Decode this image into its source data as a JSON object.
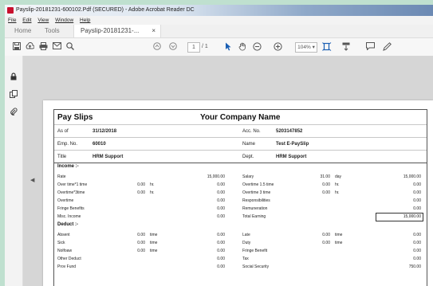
{
  "window": {
    "title": "Payslip-20181231-600102.Pdf (SECURED) - Adobe Acrobat Reader DC"
  },
  "menu": [
    "File",
    "Edit",
    "View",
    "Window",
    "Help"
  ],
  "tabs": {
    "home": "Home",
    "tools": "Tools",
    "document": "Payslip-20181231-...",
    "close": "×"
  },
  "toolbar": {
    "page_current": "1",
    "page_total": "/ 1",
    "zoom": "104%"
  },
  "icons": {
    "save": "save-icon",
    "upload": "upload-icon",
    "print": "print-icon",
    "email": "email-icon",
    "search": "search-icon",
    "prev": "prev-page-icon",
    "next": "next-page-icon",
    "select": "select-cursor-icon",
    "hand": "hand-icon",
    "zoom_out": "zoom-out-icon",
    "zoom_in": "zoom-in-icon",
    "fit": "fit-page-icon",
    "scroll": "scroll-mode-icon",
    "comment": "comment-icon",
    "pen": "pen-icon",
    "lock": "lock-icon",
    "pages": "pages-icon",
    "attach": "attachment-icon",
    "collapse": "collapse-arrow-icon"
  },
  "colors": {
    "background": "#bfe0cf",
    "accent": "#1a5fb4"
  },
  "payslip": {
    "title": "Pay Slips",
    "company": "Your Company Name",
    "header": [
      {
        "label": "As of",
        "value": "31/12/2018",
        "label2": "Acc. No.",
        "value2": "5203147852"
      },
      {
        "label": "Emp. No.",
        "value": "60010",
        "label2": "Name",
        "value2": "Test E-PaySlip"
      },
      {
        "label": "Title",
        "value": "HRM Support",
        "label2": "Dept.",
        "value2": "HRM Support"
      }
    ],
    "income_label": "Income :-",
    "income_rows": [
      {
        "a": "Rate",
        "b": "",
        "c": "",
        "d": "15,000.00",
        "e": "Salary",
        "f": "31.00",
        "g": "day",
        "h": "15,000.00"
      },
      {
        "a": "Over time*1 time",
        "b": "0.00",
        "c": "hr.",
        "d": "0.00",
        "e": "Overtime 1.5 time",
        "f": "0.00",
        "g": "hr.",
        "h": "0.00"
      },
      {
        "a": "Overtime*3time",
        "b": "0.00",
        "c": "hr.",
        "d": "0.00",
        "e": "Overtime 3 time",
        "f": "0.00",
        "g": "hr.",
        "h": "0.00"
      },
      {
        "a": "Overtime",
        "b": "",
        "c": "",
        "d": "0.00",
        "e": "Responsibilities",
        "f": "",
        "g": "",
        "h": "0.00"
      },
      {
        "a": "Fringe Benefits",
        "b": "",
        "c": "",
        "d": "0.00",
        "e": "Remuneration",
        "f": "",
        "g": "",
        "h": "0.00"
      },
      {
        "a": "Misc. Income",
        "b": "",
        "c": "",
        "d": "0.00",
        "e": "Total Earning",
        "f": "",
        "g": "",
        "h": "15,000.00"
      }
    ],
    "deduct_label": "Deduct :-",
    "deduct_rows": [
      {
        "a": "Absent",
        "b": "0.00",
        "c": "time",
        "d": "0.00",
        "e": "Late",
        "f": "0.00",
        "g": "time",
        "h": "0.00"
      },
      {
        "a": "Sick",
        "b": "0.00",
        "c": "time",
        "d": "0.00",
        "e": "Duty",
        "f": "0.00",
        "g": "time",
        "h": "0.00"
      },
      {
        "a": "Nolfoaw",
        "b": "0.00",
        "c": "time",
        "d": "0.00",
        "e": "Fringe Benefit",
        "f": "",
        "g": "",
        "h": "0.00"
      },
      {
        "a": "Other Deduct",
        "b": "",
        "c": "",
        "d": "0.00",
        "e": "Tax",
        "f": "",
        "g": "",
        "h": "0.00"
      },
      {
        "a": "Prov Fund",
        "b": "",
        "c": "",
        "d": "0.00",
        "e": "Social Security",
        "f": "",
        "g": "",
        "h": "750.00"
      }
    ]
  }
}
